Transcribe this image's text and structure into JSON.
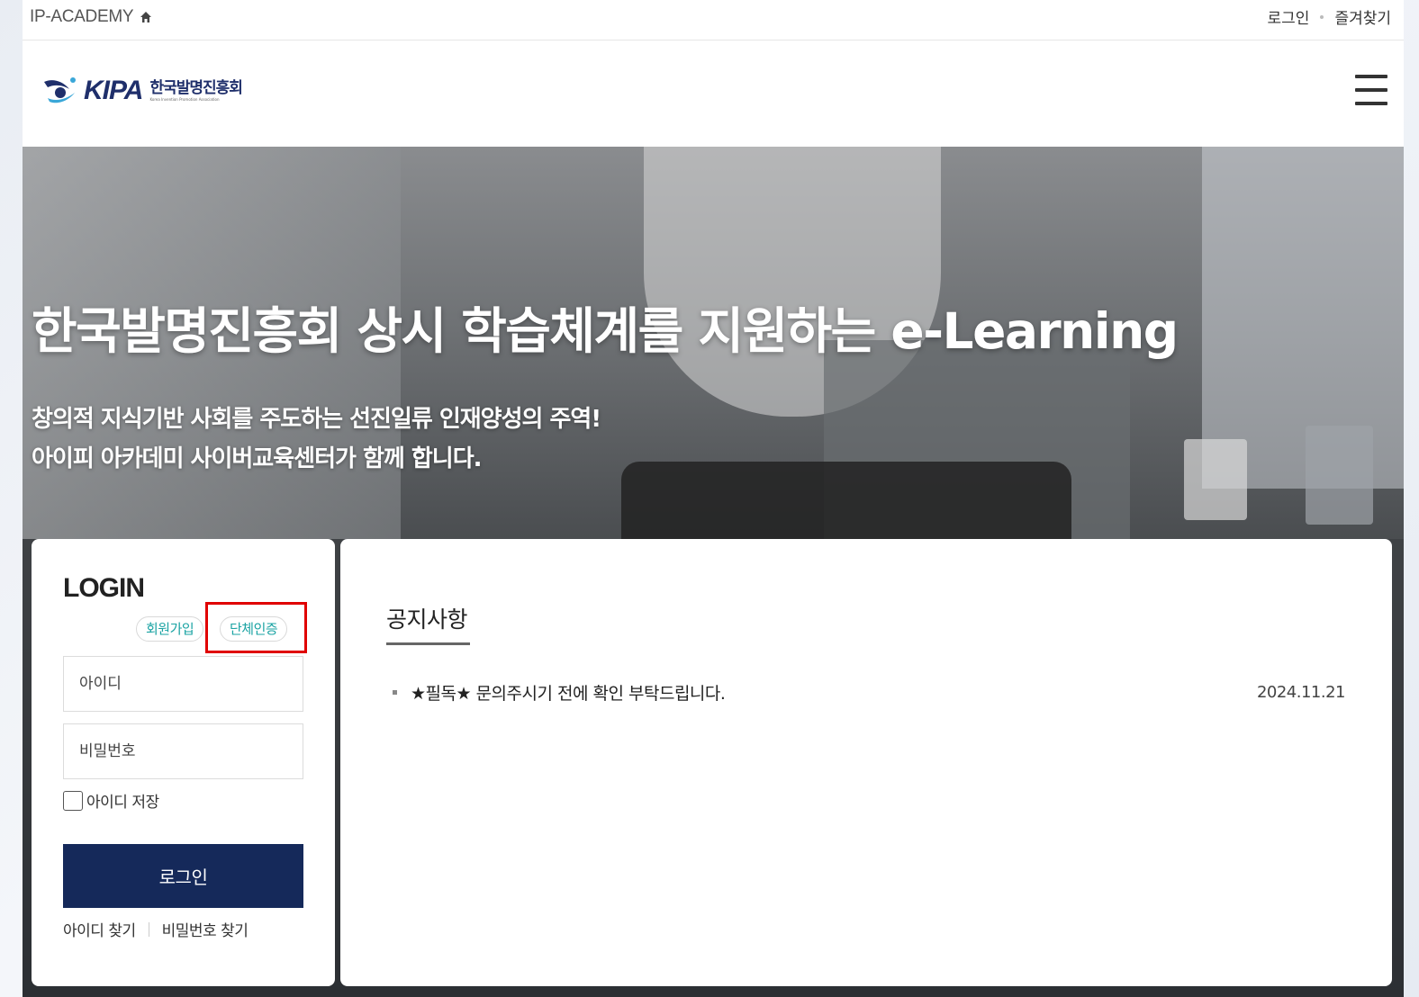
{
  "util_bar": {
    "site_name": "IP-ACADEMY",
    "links": [
      "로그인",
      "즐겨찾기"
    ]
  },
  "header": {
    "logo_en": "KIPA",
    "logo_kr": "한국발명진흥회",
    "logo_kr_sub": "Korea Invention Promotion Association"
  },
  "hero": {
    "title": "한국발명진흥회 상시 학습체계를 지원하는 e-Learning",
    "subtitle_lines": [
      "창의적 지식기반 사회를 주도하는 선진일류 인재양성의 주역!",
      "아이피 아카데미 사이버교육센터가 함께 합니다."
    ]
  },
  "login": {
    "title": "LOGIN",
    "signup_label": "회원가입",
    "group_auth_label": "단체인증",
    "id_placeholder": "아이디",
    "password_placeholder": "비밀번호",
    "remember_label": "아이디 저장",
    "submit_label": "로그인",
    "find_id_label": "아이디 찾기",
    "find_password_label": "비밀번호 찾기"
  },
  "notice": {
    "title": "공지사항",
    "items": [
      {
        "text": "★필독★ 문의주시기 전에 확인 부탁드립니다.",
        "date": "2024.11.21"
      }
    ]
  },
  "colors": {
    "brand_navy": "#15295a",
    "accent_teal": "#1aa3a3",
    "highlight_red": "#e00000"
  }
}
